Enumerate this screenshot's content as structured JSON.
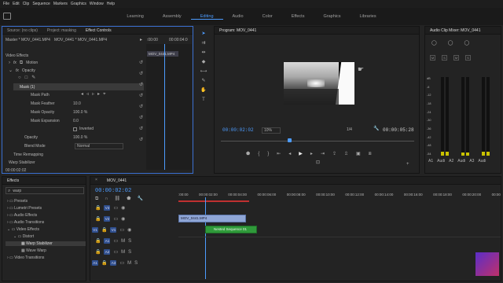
{
  "menu": [
    "File",
    "Edit",
    "Clip",
    "Sequence",
    "Markers",
    "Graphics",
    "Window",
    "Help"
  ],
  "workspaces": [
    "Learning",
    "Assembly",
    "Editing",
    "Audio",
    "Color",
    "Effects",
    "Graphics",
    "Libraries"
  ],
  "active_workspace": "Editing",
  "source_panel": {
    "tabs": [
      "Source: (no clips)",
      "Project: masking",
      "Effect Controls"
    ],
    "master": "Master * MOV_0441.MP4",
    "clip": "MOV_0441 * MOV_0441.MP4",
    "mini_tc": [
      ":00:00",
      "00:00:04:0"
    ],
    "clip_label": "MOV_0441.MP4",
    "section": "Video Effects",
    "rows": {
      "motion": "Motion",
      "opacity": "Opacity",
      "mask": "Mask (1)",
      "mask_path": "Mask Path",
      "mask_feather": "Mask Feather",
      "mask_feather_v": "10.0",
      "mask_opacity": "Mask Opacity",
      "mask_opacity_v": "100.0 %",
      "mask_expansion": "Mask Expansion",
      "mask_expansion_v": "0.0",
      "inverted": "Inverted",
      "opacity2": "Opacity",
      "opacity2_v": "100.0 %",
      "blend": "Blend Mode",
      "blend_v": "Normal",
      "remap": "Time Remapping",
      "warp": "Warp Stabilizer"
    },
    "timecode": "00:00:02:02"
  },
  "program": {
    "title": "Program: MOV_0441",
    "timecode": "00:00:02:02",
    "zoom": "10%",
    "quality": "1/4",
    "duration": "00:00:05:28"
  },
  "mixer": {
    "title": "Audio Clip Mixer: MOV_0441",
    "db_labels": [
      "dB",
      "-6",
      "-12",
      "-18",
      "-24",
      "-30",
      "-36",
      "-42",
      "-48",
      "-54"
    ],
    "channels": [
      "A1",
      "Audi",
      "A2",
      "Audi",
      "A3",
      "Audi"
    ],
    "levels": [
      0.05,
      0.04,
      0.05
    ]
  },
  "effects_panel": {
    "title": "Effects",
    "search": "warp",
    "items": [
      "Presets",
      "Lumetri Presets",
      "Audio Effects",
      "Audio Transitions",
      "Video Effects",
      "Distort",
      "Warp Stabilizer",
      "Wave Warp",
      "Video Transitions"
    ]
  },
  "timeline": {
    "tab": "MOV_0441",
    "timecode": "00:00:02:02",
    "ruler": [
      ":00:00",
      "00:00:02:00",
      "00:00:04:00",
      "00:00:06:00",
      "00:00:08:00",
      "00:00:10:00",
      "00:00:12:00",
      "00:00:14:00",
      "00:00:16:00",
      "00:00:18:00",
      "00:00:20:00",
      "00:00"
    ],
    "tracks": [
      "V3",
      "V2",
      "V1",
      "A1",
      "A2",
      "A3"
    ],
    "src_patch": [
      "V1",
      "A1"
    ],
    "clip_v2": "MOV_0441.MP4",
    "clip_v1": "Nested Sequence 01"
  }
}
